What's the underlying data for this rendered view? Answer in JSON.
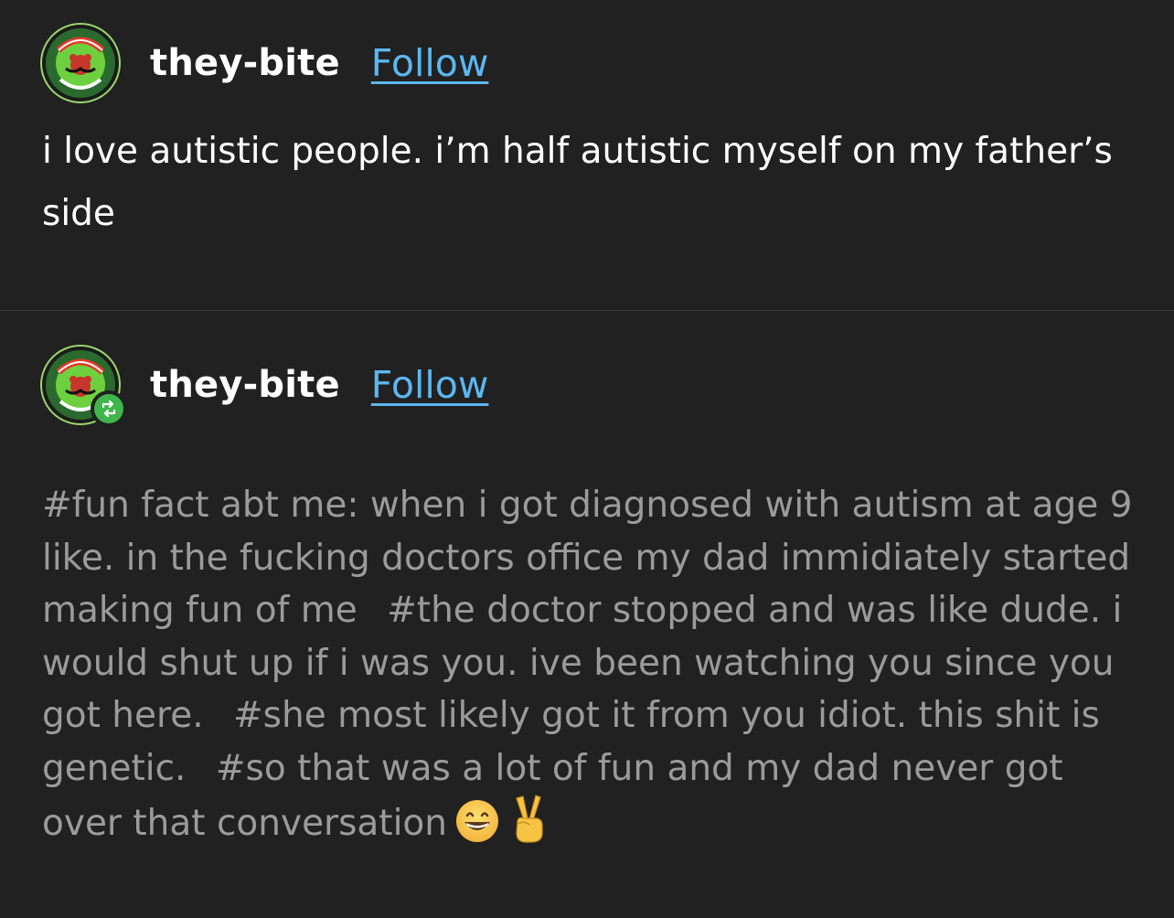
{
  "posts": [
    {
      "username": "they-bite",
      "follow_label": "Follow",
      "avatar_icon": "fenton-works-logo-icon",
      "body": "i love autistic people. i’m half autistic myself on my father’s side"
    },
    {
      "username": "they-bite",
      "follow_label": "Follow",
      "avatar_icon": "fenton-works-logo-icon",
      "badge_icon": "reblog-icon",
      "tags": [
        "#fun fact abt me: when i got diagnosed with autism at age 9 like. in the fucking doctors office my dad immidiately started making fun of me",
        "#the doctor stopped and was like dude. i would shut up if i was you. ive been watching you since you got here.",
        "#she most likely got it from you idiot. this shit is genetic.",
        "#so that was a lot of fun and my dad never got over that conversation"
      ],
      "trailing_emojis": [
        "grinning-face-emoji",
        "victory-hand-emoji"
      ]
    }
  ],
  "colors": {
    "background": "#212121",
    "text": "#ffffff",
    "tag_text": "#9b9b9b",
    "link": "#5cb7f0",
    "reblog_badge": "#3fb64c"
  }
}
